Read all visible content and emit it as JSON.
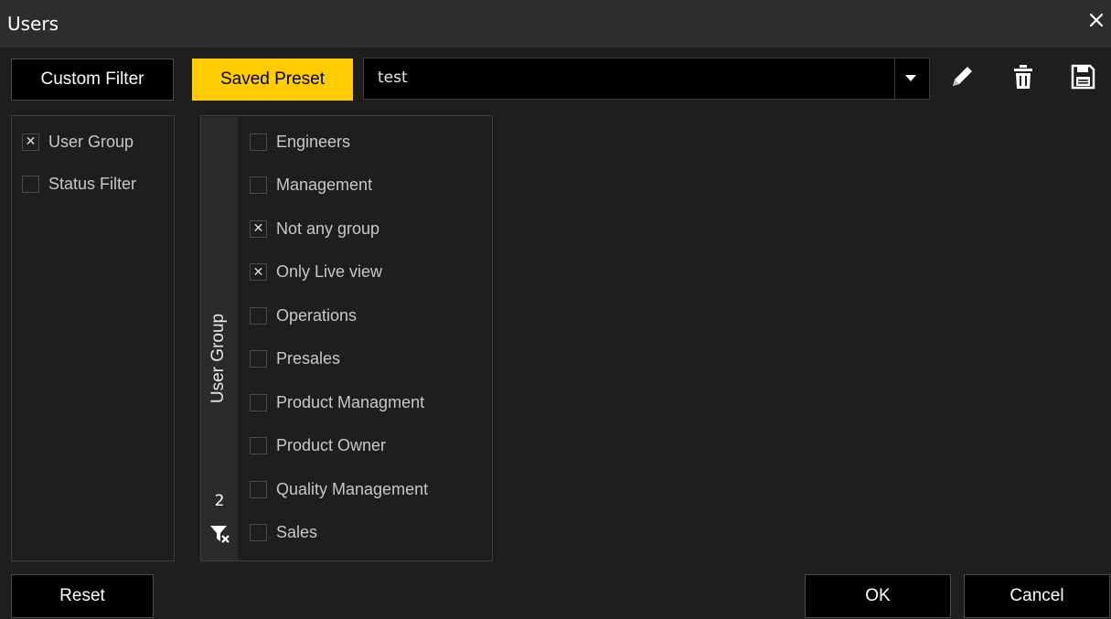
{
  "window": {
    "title": "Users",
    "close_icon": "close-icon"
  },
  "toolbar": {
    "custom_filter_label": "Custom Filter",
    "saved_preset_label": "Saved Preset",
    "preset_value": "test",
    "active_color": "#ffcc00",
    "icons": [
      "pencil-icon",
      "trash-icon",
      "save-icon"
    ]
  },
  "filters": [
    {
      "label": "User Group",
      "checked": true
    },
    {
      "label": "Status Filter",
      "checked": false
    }
  ],
  "group_panel": {
    "header": "User Group",
    "selected_count": "2",
    "clear_icon": "clear-filter-icon",
    "items": [
      {
        "label": "Engineers",
        "checked": false
      },
      {
        "label": "Management",
        "checked": false
      },
      {
        "label": "Not any group",
        "checked": true
      },
      {
        "label": "Only Live view",
        "checked": true
      },
      {
        "label": "Operations",
        "checked": false
      },
      {
        "label": "Presales",
        "checked": false
      },
      {
        "label": "Product Managment",
        "checked": false
      },
      {
        "label": "Product Owner",
        "checked": false
      },
      {
        "label": "Quality Management",
        "checked": false
      },
      {
        "label": "Sales",
        "checked": false
      }
    ]
  },
  "footer": {
    "reset_label": "Reset",
    "ok_label": "OK",
    "cancel_label": "Cancel"
  }
}
